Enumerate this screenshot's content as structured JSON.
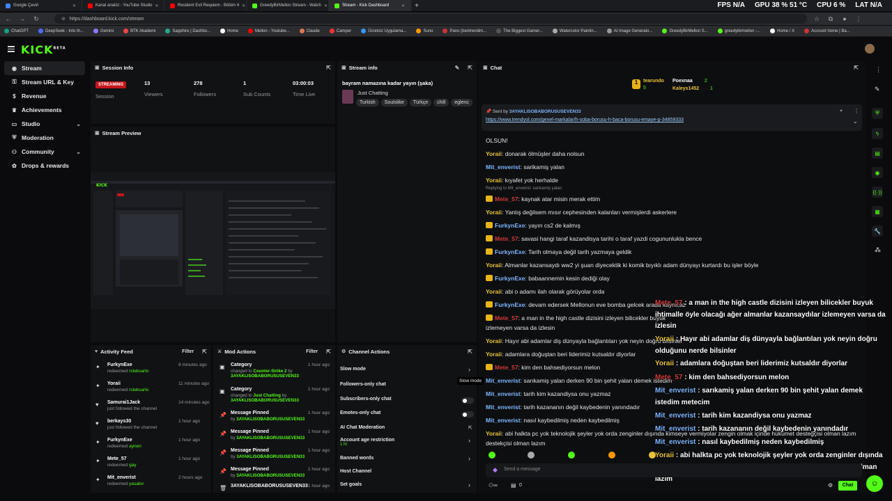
{
  "browser": {
    "tabs": [
      {
        "title": "Google Çeviri",
        "color": "#4285f4"
      },
      {
        "title": "Kanal analizi - YouTube Studio",
        "color": "#ff0000"
      },
      {
        "title": "Resident Evil Requiem - Bölüm 4",
        "color": "#ff0000"
      },
      {
        "title": "GreedyBirMellon Stream - Watch",
        "color": "#53fc18"
      },
      {
        "title": "Stream - Kick Dashboard",
        "color": "#53fc18"
      }
    ],
    "active_tab": 4,
    "url": "https://dashboard.kick.com/stream",
    "hud": {
      "fps_label": "FPS",
      "fps": "N/A",
      "gpu_label": "GPU",
      "gpu": "38 % 51 °C",
      "cpu_label": "CPU",
      "cpu": "6 %",
      "lat_label": "LAT",
      "lat": "N/A"
    },
    "bookmarks": [
      "ChatGPT",
      "DeepSeek - Into th...",
      "Gemini",
      "BTK Akademi",
      "Sapphire | Dashbo...",
      "Home",
      "Mellon - Youtube...",
      "Claude",
      "Camper",
      "Ücretsiz Uygulama...",
      "Suno",
      "Pano (bentrendim...",
      "The Biggest Gamer...",
      "Watercolor Paintin...",
      "AI Image Generato...",
      "GreedyBirMellon S...",
      "greedybirmellon -...",
      "Home / X",
      "Account home | Ba..."
    ]
  },
  "kick": {
    "logo": "KICK",
    "beta": "BETA"
  },
  "sidebar": {
    "items": [
      {
        "label": "Stream",
        "icon": "broadcast-icon"
      },
      {
        "label": "Stream URL & Key",
        "icon": "link-icon"
      },
      {
        "label": "Revenue",
        "icon": "dollar-icon"
      },
      {
        "label": "Achievements",
        "icon": "trophy-icon"
      },
      {
        "label": "Studio",
        "icon": "monitor-icon"
      },
      {
        "label": "Moderation",
        "icon": "shield-icon"
      },
      {
        "label": "Community",
        "icon": "users-icon"
      },
      {
        "label": "Drops & rewards",
        "icon": "gift-icon"
      }
    ]
  },
  "session": {
    "title": "Session Info",
    "badge": "STREAMING",
    "session_label": "Session",
    "stats": [
      {
        "value": "13",
        "label": "Viewers"
      },
      {
        "value": "278",
        "label": "Followers"
      },
      {
        "value": "1",
        "label": "Sub Counts"
      },
      {
        "value": "03:00:03",
        "label": "Time Live"
      }
    ]
  },
  "preview": {
    "title": "Stream Preview"
  },
  "stream_info": {
    "title": "Stream info",
    "stream_title": "bayram namazına kadar yayın (şaka)",
    "category": "Just Chatting",
    "tags": [
      "Turkish",
      "Soulslike",
      "Türkçe",
      "chill",
      "eglenc"
    ]
  },
  "chat": {
    "title": "Chat",
    "leaderboard": [
      {
        "rank": "1",
        "name": "tearundo",
        "points": "5"
      },
      {
        "name": "Poexnaa",
        "points": "2"
      },
      {
        "name": "Kaleys1452",
        "points": "1"
      }
    ],
    "pinned": {
      "sent_by_label": "Sent by",
      "sender": "3AYAKLISOBABORUSUSEVEN33",
      "link": "https://www.trendyol.com/genel-markalar/h-soba-borusu-h-baca-borusu-emaye-p-34859333"
    },
    "messages": [
      {
        "user": "",
        "text": "OLSUN!",
        "color": "#e6e6e6",
        "badge": false
      },
      {
        "user": "Yoraii",
        "text": "donarak ölmüşler daha nolsun",
        "color": "#e8c33a",
        "badge": false
      },
      {
        "user": "Mit_enverist",
        "text": "sarikamiş yalan",
        "color": "#7fb6ff",
        "badge": false
      },
      {
        "user": "Yoraii",
        "text": "kıyafet yok herhalde",
        "color": "#e8c33a",
        "badge": false
      },
      {
        "user": "Mete_57",
        "text": "kaynak atar misin merak ettim",
        "color": "#d03a3a",
        "badge": true,
        "reply": "Replying to Mit_enverist: sarıkamiş yalan"
      },
      {
        "user": "Yoraii",
        "text": "Yanlış değilsem mısır cephesinden kalanları vermişlerdi askerlere",
        "color": "#e8c33a",
        "badge": false
      },
      {
        "user": "FurkynExe",
        "text": "yayın cs2 de kalmış",
        "color": "#7fb6ff",
        "badge": true
      },
      {
        "user": "Mete_57",
        "text": "savasi hangi taraf kazandisya tarihi o taraf yazdi cogununlukla bence",
        "color": "#d03a3a",
        "badge": true
      },
      {
        "user": "FurkynExe",
        "text": "Tarih olmaya değil tarih yazmaya geldik",
        "color": "#7fb6ff",
        "badge": true
      },
      {
        "user": "Yoraii",
        "text": "Almanlar kazansaydı ww2 yi şuan diyecektik ki komik bıyıklı adam dünyayı kurtardı bu işler böyle",
        "color": "#e8c33a",
        "badge": false
      },
      {
        "user": "FurkynExe",
        "text": "babaannemin kesin dediği olay",
        "color": "#7fb6ff",
        "badge": true
      },
      {
        "user": "Yoraii",
        "text": "abi o adamı ilah olarak görüyolar orda",
        "color": "#e8c33a",
        "badge": false
      },
      {
        "user": "FurkynExe",
        "text": "devam edersek Mellonun eve bomba gelcek arada kaynicaz",
        "color": "#7fb6ff",
        "badge": true
      },
      {
        "user": "Mete_57",
        "text": "a man in the high castle dizisini izleyen bilicekler buyuk",
        "color": "#d03a3a",
        "badge": true
      },
      {
        "user": "",
        "text": "izlemeyen varsa da izlesin",
        "color": "#e6e6e6",
        "badge": false
      },
      {
        "user": "Yoraii",
        "text": "Hayır abi adamlar diş dünyayla bağlantıları yok neyin doğru bilsinler",
        "color": "#e8c33a",
        "badge": false
      },
      {
        "user": "Yoraii",
        "text": "adamlara doğuştan beri liderimiz kutsaldır diyorlar",
        "color": "#e8c33a",
        "badge": false
      },
      {
        "user": "Mete_57",
        "text": "kim den bahsediyorsun melon",
        "color": "#d03a3a",
        "badge": true
      },
      {
        "user": "Mit_enverist",
        "text": "sarıkamiş yalan derken 90 bin şehit yalan demek istedim",
        "color": "#7fb6ff",
        "badge": false
      },
      {
        "user": "Mit_enverist",
        "text": "tarih kim kazandiysa onu yazmaz",
        "color": "#7fb6ff",
        "badge": false
      },
      {
        "user": "Mit_enverist",
        "text": "tarih kazananın değil kaybedenin yanındadır",
        "color": "#7fb6ff",
        "badge": false
      },
      {
        "user": "Mit_enverist",
        "text": "nasıl kaybedilmiş neden kaybedilmiş",
        "color": "#7fb6ff",
        "badge": false
      },
      {
        "user": "Yoraii",
        "text": "abi halkta pc yok teknolojik şeyler yok orda zenginler dışında kimseye vermiyolar zengin olmak içinde hükümet desteğçisi olman lazım",
        "color": "#e8c33a",
        "badge": false
      },
      {
        "user": "",
        "text": "destekçisi olman lazım",
        "color": "#e6e6e6",
        "badge": false
      }
    ],
    "overlay": [
      {
        "user": "Mete_57",
        "text": "a man in the high castle dizisini izleyen bilicekler buyuk"
      },
      {
        "user": "",
        "text": "ihtimalle öyle olacağı ağer almanlar kazansaydılar izlemeyen varsa da"
      },
      {
        "user": "",
        "text": "izlesin"
      },
      {
        "user": "Yoraii",
        "text": "Hayır abi adamlar diş dünyayla bağlantıları yok neyin doğru"
      },
      {
        "user": "",
        "text": "olduğunu nerde bilsinler"
      },
      {
        "user": "Yoraii",
        "text": "adamlara doğuştan beri liderimiz kutsaldır diyorlar"
      },
      {
        "user": "Mete_57",
        "text": "kim den bahsediyorsun melon"
      },
      {
        "user": "Mit_enverist",
        "text": "sarıkamiş yalan derken 90 bin şehit yalan demek"
      },
      {
        "user": "",
        "text": "istedim metecim"
      },
      {
        "user": "Mit_enverist",
        "text": "tarih kim kazandiysa onu yazmaz"
      },
      {
        "user": "Mit_enverist",
        "text": "tarih kazananın değil kaybedenin yanındadır"
      },
      {
        "user": "Mit_enverist",
        "text": "nasıl kaybedilmiş neden kaybedilmiş"
      },
      {
        "user": "Yoraii",
        "text": "abi halkta pc yok teknolojik şeyler yok orda zenginler dışında"
      },
      {
        "user": "",
        "text": "kimseye vermiyolar zengin olmak içinde hükümet destekçisi olman"
      },
      {
        "user": "",
        "text": "lazım"
      }
    ],
    "input_placeholder": "Send a message",
    "points": "0",
    "send_label": "Chat"
  },
  "activity": {
    "title": "Activity Feed",
    "filter": "Filter",
    "items": [
      {
        "name": "FurkynExe",
        "action": "redeemed",
        "reward": "rsteksarlo",
        "time": "9 minutes ago",
        "icon": "reward-icon"
      },
      {
        "name": "Yoraii",
        "action": "redeemed",
        "reward": "rsteksarlo",
        "time": "11 minutes ago",
        "icon": "reward-icon"
      },
      {
        "name": "Samurai1Jack",
        "action": "just followed the channel",
        "reward": "",
        "time": "14 minutes ago",
        "icon": "heart-icon"
      },
      {
        "name": "berkays30",
        "action": "just followed the channel",
        "reward": "",
        "time": "1 hour ago",
        "icon": "heart-icon"
      },
      {
        "name": "FurkynExe",
        "action": "redeemed",
        "reward": "aynen",
        "time": "1 hour ago",
        "icon": "reward-icon"
      },
      {
        "name": "Mete_57",
        "action": "redeemed",
        "reward": "gay",
        "time": "1 hour ago",
        "icon": "reward-icon"
      },
      {
        "name": "Mit_enverist",
        "action": "redeemed",
        "reward": "yasabır",
        "time": "2 hours ago",
        "icon": "reward-icon"
      }
    ]
  },
  "mod": {
    "title": "Mod Actions",
    "filter": "Filter",
    "items": [
      {
        "title": "Category",
        "pre": "changed to",
        "target": "Counter-Strike 2",
        "by": "by",
        "user": "3AYAKLISOBABORUSUSEVEN33",
        "time": "1 hour ago",
        "icon": "category-icon"
      },
      {
        "title": "Category",
        "pre": "changed to",
        "target": "Just Chatting",
        "by": "by",
        "user": "3AYAKLISOBABORUSUSEVEN33",
        "time": "1 hour ago",
        "icon": "category-icon"
      },
      {
        "title": "Message Pinned",
        "pre": "by",
        "target": "",
        "by": "",
        "user": "3AYAKLISOBABORUSUSEVEN33",
        "time": "1 hour ago",
        "icon": "pin-icon"
      },
      {
        "title": "Message Pinned",
        "pre": "by",
        "target": "",
        "by": "",
        "user": "3AYAKLISOBABORUSUSEVEN33",
        "time": "1 hour ago",
        "icon": "pin-icon"
      },
      {
        "title": "Message Pinned",
        "pre": "by",
        "target": "",
        "by": "",
        "user": "3AYAKLISOBABORUSUSEVEN33",
        "time": "1 hour ago",
        "icon": "pin-icon"
      },
      {
        "title": "Message Pinned",
        "pre": "by",
        "target": "",
        "by": "",
        "user": "3AYAKLISOBABORUSUSEVEN33",
        "time": "1 hour ago",
        "icon": "pin-icon"
      },
      {
        "title": "3AYAKLISOBABORUSUSEVEN33",
        "pre": "",
        "target": "",
        "by": "",
        "user": "",
        "time": "1 hour ago",
        "icon": "trash-icon"
      }
    ]
  },
  "channel_actions": {
    "title": "Channel Actions",
    "items": [
      {
        "label": "Slow mode",
        "kind": "chevron",
        "sub": ""
      },
      {
        "label": "Followers-only chat",
        "kind": "none",
        "sub": ""
      },
      {
        "label": "Subscribers-only chat",
        "kind": "toggle",
        "sub": ""
      },
      {
        "label": "Emotes-only chat",
        "kind": "toggle",
        "sub": ""
      },
      {
        "label": "AI Chat Moderation",
        "kind": "external",
        "sub": ""
      },
      {
        "label": "Account age restriction",
        "kind": "chevron",
        "sub": "1 hr"
      },
      {
        "label": "Banned words",
        "kind": "chevron",
        "sub": ""
      },
      {
        "label": "Host Channel",
        "kind": "none",
        "sub": ""
      },
      {
        "label": "Set goals",
        "kind": "chevron",
        "sub": ""
      }
    ],
    "tooltip": "Slow mode"
  },
  "colors": {
    "accent": "#53fc18",
    "live": "#c3161c",
    "panel": "#111214",
    "bg": "#0b0b0d"
  }
}
